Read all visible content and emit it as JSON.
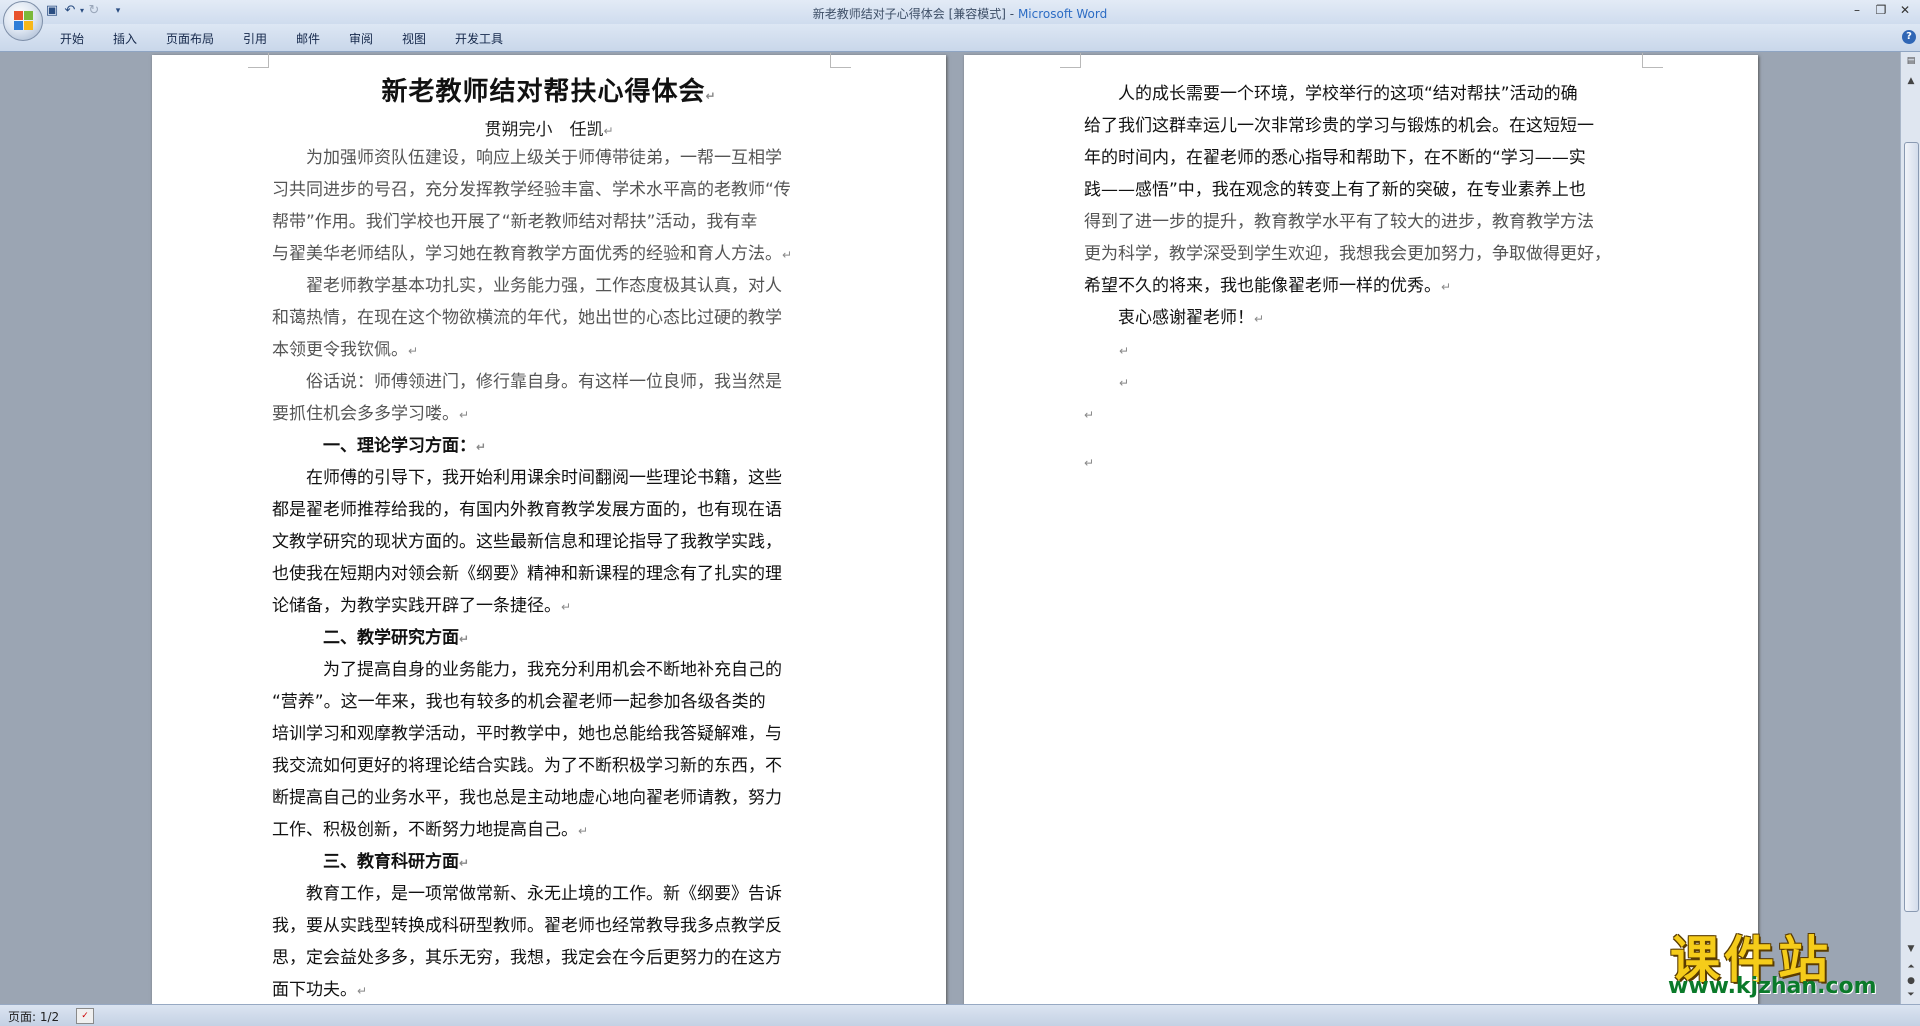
{
  "window": {
    "title": "新老教师结对子心得体会 [兼容模式]",
    "app": "Microsoft Word",
    "separator": " - "
  },
  "ribbon": {
    "tabs": [
      "开始",
      "插入",
      "页面布局",
      "引用",
      "邮件",
      "审阅",
      "视图",
      "开发工具"
    ]
  },
  "page1": {
    "title": "新老教师结对帮扶心得体会",
    "author": "贯朔完小　任凯",
    "lines": [
      "　　为加强师资队伍建设，响应上级关于师傅带徒弟，一帮一互相学",
      "习共同进步的号召，充分发挥教学经验丰富、学术水平高的老教师“传",
      "帮带”作用。我们学校也开展了“新老教师结对帮扶”活动，我有幸",
      "与翟美华老师结队，学习她在教育教学方面优秀的经验和育人方法。",
      "　　翟老师教学基本功扎实，业务能力强，工作态度极其认真，对人",
      "和蔼热情，在现在这个物欲横流的年代，她出世的心态比过硬的教学",
      "本领更令我钦佩。",
      "　　俗话说：师傅领进门，修行靠自身。有这样一位良师，我当然是",
      "要抓住机会多多学习喽。",
      "　　　一、理论学习方面：",
      "　　在师傅的引导下，我开始利用课余时间翻阅一些理论书籍，这些",
      "都是翟老师推荐给我的，有国内外教育教学发展方面的，也有现在语",
      "文教学研究的现状方面的。这些最新信息和理论指导了我教学实践，",
      "也使我在短期内对领会新《纲要》精神和新课程的理念有了扎实的理",
      "论储备，为教学实践开辟了一条捷径。",
      "　　　二、教学研究方面",
      "　　　为了提高自身的业务能力，我充分利用机会不断地补充自己的",
      "“营养”。这一年来，我也有较多的机会翟老师一起参加各级各类的",
      "培训学习和观摩教学活动，平时教学中，她也总能给我答疑解难，与",
      "我交流如何更好的将理论结合实践。为了不断积极学习新的东西，不",
      "断提高自己的业务水平，我也总是主动地虚心地向翟老师请教，努力",
      "工作、积极创新，不断努力地提高自己。",
      "　　　三、教育科研方面",
      "　　教育工作，是一项常做常新、永无止境的工作。新《纲要》告诉",
      "我，要从实践型转换成科研型教师。翟老师也经常教导我多点教学反",
      "思，定会益处多多，其乐无穷，我想，我定会在今后更努力的在这方",
      "面下功夫。"
    ]
  },
  "page2": {
    "lines": [
      "　　人的成长需要一个环境，学校举行的这项“结对帮扶”活动的确",
      "给了我们这群幸运儿一次非常珍贵的学习与锻炼的机会。在这短短一",
      "年的时间内，在翟老师的悉心指导和帮助下，在不断的“学习——实",
      "践——感悟”中，我在观念的转变上有了新的突破，在专业素养上也",
      "得到了进一步的提升，教育教学水平有了较大的进步，教育教学方法",
      "更为科学，教学深受到学生欢迎，我想我会更加努力，争取做得更好，",
      "希望不久的将来，我也能像翟老师一样的优秀。",
      "　　衷心感谢翟老师！"
    ]
  },
  "statusbar": {
    "page_count": "页面: 1/2"
  },
  "watermark": {
    "text": "课件站",
    "url": "www.kjzhan.com"
  }
}
